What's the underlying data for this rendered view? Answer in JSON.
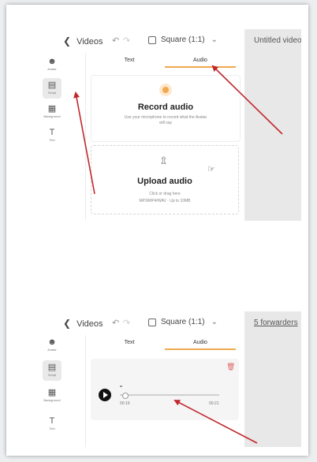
{
  "top": {
    "back_label": "Videos",
    "aspect_label": "Square (1:1)",
    "canvas_title": "Untitled video",
    "rail": [
      {
        "label": "Avatar",
        "icon": "person-icon"
      },
      {
        "label": "Script",
        "icon": "script-icon"
      },
      {
        "label": "Background",
        "icon": "grid-icon"
      },
      {
        "label": "Text",
        "icon": "text-icon"
      }
    ],
    "tabs": [
      "Text",
      "Audio"
    ],
    "record_title": "Record audio",
    "record_sub": "Use your microphone to record what the Avatar will say",
    "upload_title": "Upload audio",
    "upload_sub1": "Click or drag here",
    "upload_sub2": "MP3/MP4/WAV · Up to 10MB"
  },
  "bottom": {
    "back_label": "Videos",
    "aspect_label": "Square (1:1)",
    "canvas_title": "5 forwarders",
    "rail": [
      {
        "label": "Avatar",
        "icon": "person-icon"
      },
      {
        "label": "Script",
        "icon": "script-icon"
      },
      {
        "label": "Background",
        "icon": "grid-icon"
      },
      {
        "label": "Text",
        "icon": "text-icon"
      }
    ],
    "tabs": [
      "Text",
      "Audio"
    ],
    "time_current": "00:19",
    "time_total": "00:21",
    "progress": 0.05
  },
  "colors": {
    "accent": "#f0a94e",
    "arrow": "#c0282d",
    "delete": "#e06666"
  }
}
